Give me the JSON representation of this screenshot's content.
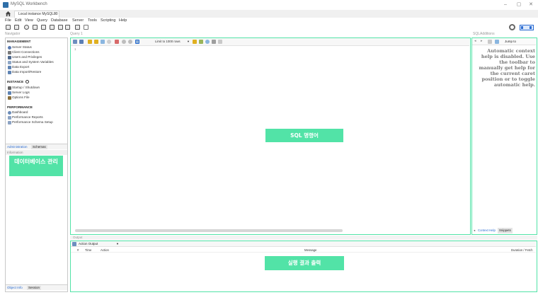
{
  "window": {
    "title": "MySQL Workbench",
    "controls": [
      "–",
      "▢",
      "✕"
    ]
  },
  "connection_tab": {
    "label": "Local instance MySQL80",
    "close": "×"
  },
  "menu": [
    "File",
    "Edit",
    "View",
    "Query",
    "Database",
    "Server",
    "Tools",
    "Scripting",
    "Help"
  ],
  "headers": {
    "navigator": "Navigator",
    "query": "Query 1",
    "sql_additions": "SQLAdditions",
    "output": "Output"
  },
  "navigator": {
    "management_title": "MANAGEMENT",
    "management_items": [
      "Server Status",
      "Client Connections",
      "Users and Privileges",
      "Status and System Variables",
      "Data Export",
      "Data Import/Restore"
    ],
    "instance_title": "INSTANCE",
    "instance_items": [
      "Startup / Shutdown",
      "Server Logs",
      "Options File"
    ],
    "performance_title": "PERFORMANCE",
    "performance_items": [
      "Dashboard",
      "Performance Reports",
      "Performance Schema Setup"
    ],
    "tab_admin": "Administration",
    "tab_schemas": "Schemas",
    "info_header": "Information",
    "obj_info": "Object Info",
    "session": "Session"
  },
  "editor": {
    "limit_label": "Limit to 1000 rows",
    "line_number": "1"
  },
  "sql_additions": {
    "jump_to": "Jump to",
    "help_text": "Automatic context help is disabled. Use the toolbar to manually get help for the current caret position or to toggle automatic help.",
    "tab_context": "Context Help",
    "tab_snippets": "Snippets"
  },
  "output": {
    "select_label": "Action Output",
    "col_num": "#",
    "col_time": "Time",
    "col_action": "Action",
    "col_message": "Message",
    "col_duration": "Duration / Fetch"
  },
  "annotations": {
    "db_manage": "데이터베이스 관리",
    "sql_cmd": "SQL 명령어",
    "result_output": "실행 결과 출력"
  },
  "colors": {
    "annotation_green": "#52e3a7",
    "accent_blue": "#2a6bd1"
  }
}
